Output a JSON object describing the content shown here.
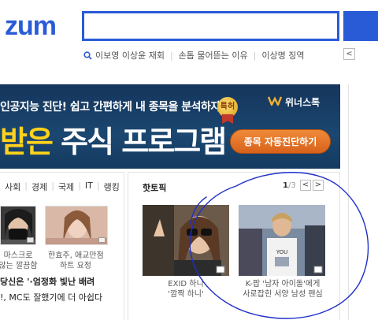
{
  "logo": {
    "text": "zum"
  },
  "search": {
    "value": ""
  },
  "hot_keywords": {
    "items": [
      "이보영 이상윤 재회",
      "손톱 물어뜯는 이유",
      "이상명 징역"
    ],
    "prev_label": "<"
  },
  "banner": {
    "line1": "인공지능 진단! 쉽고 간편하게 내 종목을 분석하자!",
    "line2_yellow": "받은",
    "line2_white": "주식 프로그램",
    "badge": "특허",
    "brand": "위너스톡",
    "cta": "종목 자동진단하기"
  },
  "news": {
    "tabs": [
      "사회",
      "경제",
      "국제",
      "IT",
      "랭킹"
    ],
    "thumbs": [
      {
        "caption_1": "마스크로",
        "caption_2": "않는 깔끔함"
      },
      {
        "caption_1": "한효주, 애교만점",
        "caption_2": "하트 요정"
      }
    ],
    "headline_1": "당신은 '·엄정화 빛난 배려",
    "headline_2": "!, MC도 잘했기에 더 아쉽다"
  },
  "hot_topic": {
    "title": "핫토픽",
    "page_current": "1",
    "page_total": "/3",
    "prev": "<",
    "next": ">",
    "items": [
      {
        "caption_1": "EXID 하니",
        "caption_2": "'깜짝 하니'"
      },
      {
        "caption_1": "K-팝 '남자 아이돌'에게",
        "caption_2": "사로잡힌 서양 남성 팬심"
      }
    ]
  },
  "colors": {
    "brand_blue": "#2a5bd7",
    "cta_orange": "#e07428",
    "annotation_blue": "#1f2fc8"
  }
}
